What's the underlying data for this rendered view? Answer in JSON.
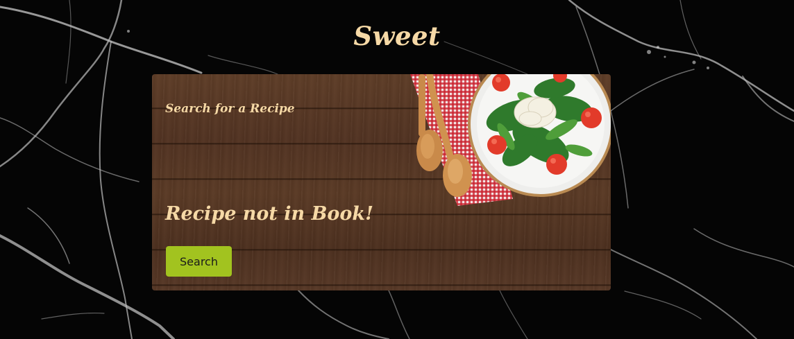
{
  "header": {
    "title": "Sweet"
  },
  "card": {
    "subtitle": "Search for a Recipe",
    "message": "Recipe not in Book!",
    "search_label": "Search"
  },
  "colors": {
    "page_background": "#050505",
    "title_text": "#f6d9a6",
    "button_background": "#a2c31f",
    "wood": "#5a3a25"
  }
}
